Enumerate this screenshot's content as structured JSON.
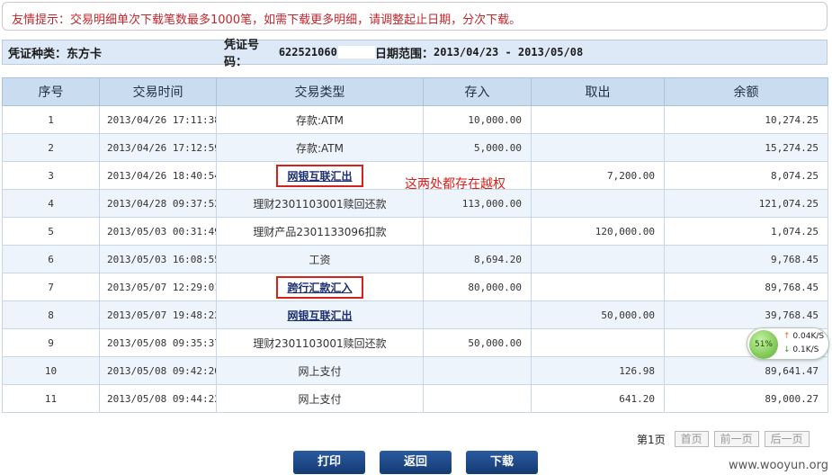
{
  "tip": "友情提示：交易明细单次下载笔数最多1000笔，如需下载更多明细，请调整起止日期，分次下载。",
  "info": {
    "voucher_type_label": "凭证种类：",
    "voucher_type_value": "东方卡",
    "voucher_no_label": "凭证号码：",
    "voucher_no_value": "622521060",
    "date_range_label": "日期范围：",
    "date_range_value": "2013/04/23 - 2013/05/08"
  },
  "table": {
    "headers": [
      "序号",
      "交易时间",
      "交易类型",
      "存入",
      "取出",
      "余额"
    ],
    "rows": [
      {
        "no": "1",
        "time": "2013/04/26 17:11:38",
        "type": "存款:ATM",
        "deposit": "10,000.00",
        "withdraw": "",
        "balance": "10,274.25"
      },
      {
        "no": "2",
        "time": "2013/04/26 17:12:59",
        "type": "存款:ATM",
        "deposit": "5,000.00",
        "withdraw": "",
        "balance": "15,274.25"
      },
      {
        "no": "3",
        "time": "2013/04/26 18:40:54",
        "type": "网银互联汇出",
        "deposit": "",
        "withdraw": "7,200.00",
        "balance": "8,074.25"
      },
      {
        "no": "4",
        "time": "2013/04/28 09:37:52",
        "type": "理财2301103001赎回还款",
        "deposit": "113,000.00",
        "withdraw": "",
        "balance": "121,074.25"
      },
      {
        "no": "5",
        "time": "2013/05/03 00:31:49",
        "type": "理财产品2301133096扣款",
        "deposit": "",
        "withdraw": "120,000.00",
        "balance": "1,074.25"
      },
      {
        "no": "6",
        "time": "2013/05/03 16:08:55",
        "type": "工资",
        "deposit": "8,694.20",
        "withdraw": "",
        "balance": "9,768.45"
      },
      {
        "no": "7",
        "time": "2013/05/07 12:29:01",
        "type": "跨行汇款汇入",
        "deposit": "80,000.00",
        "withdraw": "",
        "balance": "89,768.45"
      },
      {
        "no": "8",
        "time": "2013/05/07 19:48:22",
        "type": "网银互联汇出",
        "deposit": "",
        "withdraw": "50,000.00",
        "balance": "39,768.45"
      },
      {
        "no": "9",
        "time": "2013/05/08 09:35:37",
        "type": "理财2301103001赎回还款",
        "deposit": "50,000.00",
        "withdraw": "",
        "balance": ""
      },
      {
        "no": "10",
        "time": "2013/05/08 09:42:20",
        "type": "网上支付",
        "deposit": "",
        "withdraw": "126.98",
        "balance": "89,641.47"
      },
      {
        "no": "11",
        "time": "2013/05/08 09:44:22",
        "type": "网上支付",
        "deposit": "",
        "withdraw": "641.20",
        "balance": "89,000.27"
      }
    ]
  },
  "annotation": "这两处都存在越权",
  "speed_widget": {
    "percent": "51%",
    "up": "0.04K/S",
    "down": "0.1K/S"
  },
  "pager": {
    "current": "第1页",
    "first": "首页",
    "prev": "前一页",
    "next": "后一页"
  },
  "buttons": {
    "print": "打印",
    "back": "返回",
    "download": "下载"
  },
  "watermark": "www.wooyun.org",
  "colors": {
    "accent": "#143a72",
    "alert": "#d4221c",
    "header_bg": "#c9dcf0"
  }
}
